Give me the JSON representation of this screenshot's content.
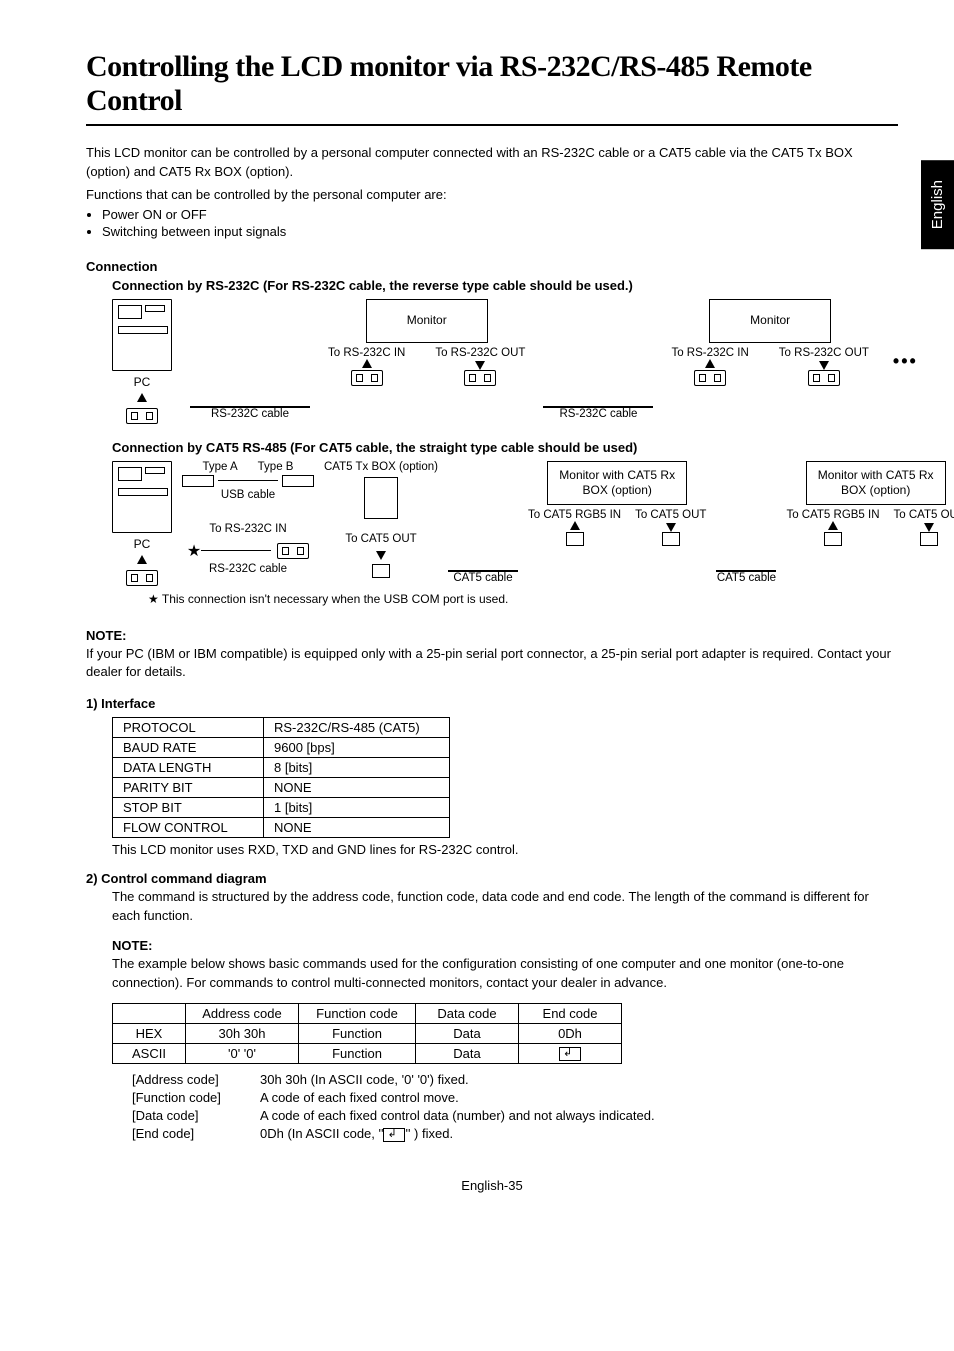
{
  "sideTab": "English",
  "title": "Controlling the LCD monitor via RS-232C/RS-485 Remote Control",
  "intro1": "This LCD monitor can be controlled by a personal computer connected with an RS-232C cable or a CAT5 cable via the CAT5 Tx BOX (option) and CAT5 Rx BOX (option).",
  "intro2": "Functions that can be controlled by the personal computer are:",
  "bullets": [
    "Power ON or OFF",
    "Switching between input signals"
  ],
  "connectionHead": "Connection",
  "conn232Head": "Connection by RS-232C  (For RS-232C cable, the reverse type cable should be used.)",
  "diag232": {
    "pc": "PC",
    "monitor": "Monitor",
    "toIn": "To RS-232C IN",
    "toOut": "To RS-232C OUT",
    "cable": "RS-232C cable"
  },
  "connCat5Head": "Connection by CAT5 RS-485  (For CAT5 cable, the straight type cable should be used)",
  "diagCat5": {
    "pc": "PC",
    "typeA": "Type A",
    "typeB": "Type B",
    "usbCable": "USB cable",
    "txBox": "CAT5 Tx BOX (option)",
    "toRs232cIn": "To RS-232C IN",
    "toCat5Out": "To CAT5 OUT",
    "toCat5Rgb5In": "To CAT5 RGB5 IN",
    "monRx": "Monitor with CAT5 Rx BOX (option)",
    "rs232cCable": "RS-232C cable",
    "cat5Cable": "CAT5 cable",
    "starNote": "This connection isn't necessary when the USB COM port is used."
  },
  "noteHead": "NOTE:",
  "noteBody": "If your PC (IBM or IBM compatible) is equipped only with a 25-pin serial port connector, a 25-pin serial port adapter is required. Contact your dealer for details.",
  "ifaceHead": "1)  Interface",
  "ifaceRows": [
    [
      "PROTOCOL",
      "RS-232C/RS-485 (CAT5)"
    ],
    [
      "BAUD RATE",
      "9600 [bps]"
    ],
    [
      "DATA LENGTH",
      "8 [bits]"
    ],
    [
      "PARITY BIT",
      "NONE"
    ],
    [
      "STOP BIT",
      "1 [bits]"
    ],
    [
      "FLOW CONTROL",
      "NONE"
    ]
  ],
  "ifaceAfter": "This LCD monitor uses RXD, TXD and GND lines for RS-232C control.",
  "cmdDiagHead": "2)  Control command diagram",
  "cmdDiagBody": "The command is structured by the address code, function code, data code and end code.  The length of the command is different for each function.",
  "note2Body": "The example below shows basic commands used for the configuration consisting of one computer and one monitor (one-to-one connection). For commands to control multi-connected monitors, contact your dealer in advance.",
  "cmdTable": {
    "headers": [
      "",
      "Address code",
      "Function code",
      "Data code",
      "End code"
    ],
    "rows": [
      [
        "HEX",
        "30h 30h",
        "Function",
        "Data",
        "0Dh"
      ],
      [
        "ASCII",
        "'0' '0'",
        "Function",
        "Data",
        "__ENTER__"
      ]
    ]
  },
  "codeDesc": [
    [
      "[Address code]",
      "30h 30h (In ASCII code, '0' '0') fixed."
    ],
    [
      "[Function code]",
      "A code of each fixed control move."
    ],
    [
      "[Data code]",
      "A code of each fixed control data (number) and not always indicated."
    ],
    [
      "[End code]",
      "0Dh (In ASCII code, '__ENTER__' ) fixed."
    ]
  ],
  "footer": "English-35"
}
